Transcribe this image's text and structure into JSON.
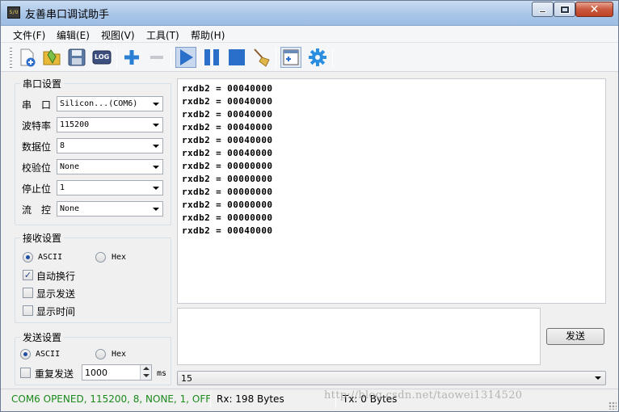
{
  "window": {
    "title": "友善串口调试助手",
    "icon_text": "S/U"
  },
  "menu": [
    {
      "label": "文件(F)"
    },
    {
      "label": "编辑(E)"
    },
    {
      "label": "视图(V)"
    },
    {
      "label": "工具(T)"
    },
    {
      "label": "帮助(H)"
    }
  ],
  "toolbar": {
    "buttons": [
      "new-session-icon",
      "open-folder-icon",
      "save-disk-icon",
      "log-icon",
      "add-plus-icon",
      "remove-minus-icon",
      "play-icon",
      "pause-icon",
      "stop-icon",
      "clear-broom-icon",
      "window-add-icon",
      "gear-icon"
    ],
    "log_label": "LOG"
  },
  "serial": {
    "title": "串口设置",
    "port_label": "串　口",
    "port_value": "Silicon...(COM6)",
    "baud_label": "波特率",
    "baud_value": "115200",
    "data_label": "数据位",
    "data_value": "8",
    "parity_label": "校验位",
    "parity_value": "None",
    "stop_label": "停止位",
    "stop_value": "1",
    "flow_label": "流　控",
    "flow_value": "None"
  },
  "receive": {
    "title": "接收设置",
    "ascii_label": "ASCII",
    "hex_label": "Hex",
    "mode": "ASCII",
    "auto_wrap_label": "自动换行",
    "auto_wrap": true,
    "show_send_label": "显示发送",
    "show_send": false,
    "show_time_label": "显示时间",
    "show_time": false
  },
  "send": {
    "title": "发送设置",
    "ascii_label": "ASCII",
    "hex_label": "Hex",
    "mode": "ASCII",
    "repeat_label": "重复发送",
    "repeat": false,
    "interval_value": "1000",
    "interval_unit": "ms",
    "button_label": "发送",
    "history_value": "15"
  },
  "rx_lines": [
    "rxdb2 = 00040000",
    "rxdb2 = 00040000",
    "rxdb2 = 00040000",
    "rxdb2 = 00040000",
    "rxdb2 = 00040000",
    "rxdb2 = 00040000",
    "rxdb2 = 00000000",
    "rxdb2 = 00000000",
    "rxdb2 = 00000000",
    "rxdb2 = 00000000",
    "rxdb2 = 00000000",
    "rxdb2 = 00040000"
  ],
  "status": {
    "connection": "COM6 OPENED, 115200, 8, NONE, 1, OFF",
    "rx": "Rx: 198 Bytes",
    "tx": "Tx: 0 Bytes",
    "watermark": "http://blog.csdn.net/taowei1314520",
    "connection_color": "#1a8a1a"
  },
  "colors": {
    "accent_blue": "#2a6fc9",
    "titlebar": "#a9c6e8"
  }
}
